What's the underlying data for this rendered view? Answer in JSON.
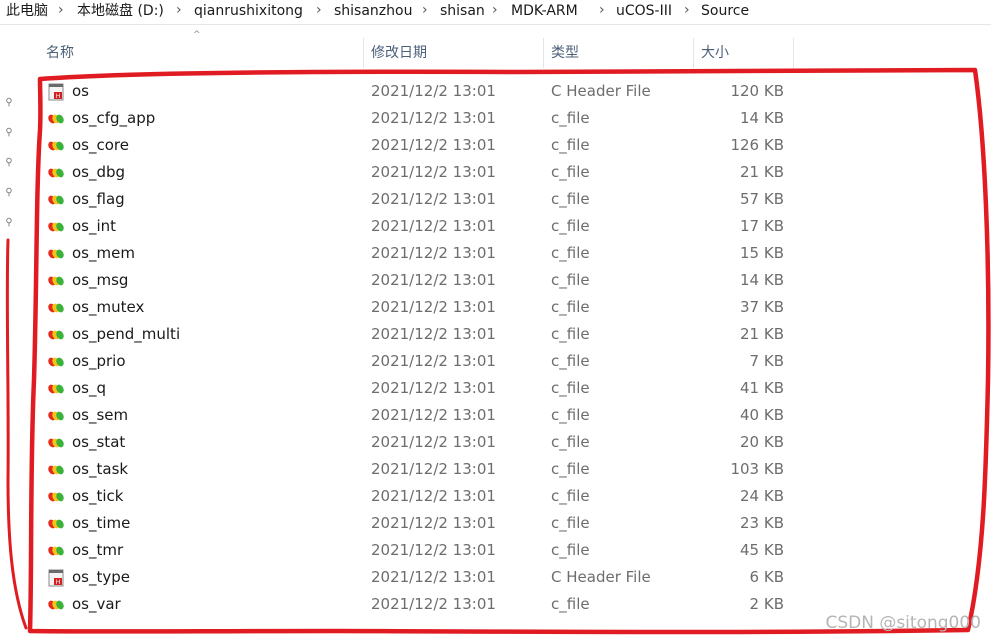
{
  "breadcrumb": [
    "此电脑",
    "本地磁盘 (D:)",
    "qianrushixitong",
    "shisanzhou",
    "shisan",
    "MDK-ARM",
    "uCOS-III",
    "Source"
  ],
  "columns": {
    "name": "名称",
    "date": "修改日期",
    "type": "类型",
    "size": "大小"
  },
  "files": [
    {
      "name": "os",
      "date": "2021/12/2 13:01",
      "type": "C Header File",
      "size": "120 KB",
      "icon": "h-file-icon"
    },
    {
      "name": "os_cfg_app",
      "date": "2021/12/2 13:01",
      "type": "c_file",
      "size": "14 KB",
      "icon": "c-file-icon"
    },
    {
      "name": "os_core",
      "date": "2021/12/2 13:01",
      "type": "c_file",
      "size": "126 KB",
      "icon": "c-file-icon"
    },
    {
      "name": "os_dbg",
      "date": "2021/12/2 13:01",
      "type": "c_file",
      "size": "21 KB",
      "icon": "c-file-icon"
    },
    {
      "name": "os_flag",
      "date": "2021/12/2 13:01",
      "type": "c_file",
      "size": "57 KB",
      "icon": "c-file-icon"
    },
    {
      "name": "os_int",
      "date": "2021/12/2 13:01",
      "type": "c_file",
      "size": "17 KB",
      "icon": "c-file-icon"
    },
    {
      "name": "os_mem",
      "date": "2021/12/2 13:01",
      "type": "c_file",
      "size": "15 KB",
      "icon": "c-file-icon"
    },
    {
      "name": "os_msg",
      "date": "2021/12/2 13:01",
      "type": "c_file",
      "size": "14 KB",
      "icon": "c-file-icon"
    },
    {
      "name": "os_mutex",
      "date": "2021/12/2 13:01",
      "type": "c_file",
      "size": "37 KB",
      "icon": "c-file-icon"
    },
    {
      "name": "os_pend_multi",
      "date": "2021/12/2 13:01",
      "type": "c_file",
      "size": "21 KB",
      "icon": "c-file-icon"
    },
    {
      "name": "os_prio",
      "date": "2021/12/2 13:01",
      "type": "c_file",
      "size": "7 KB",
      "icon": "c-file-icon"
    },
    {
      "name": "os_q",
      "date": "2021/12/2 13:01",
      "type": "c_file",
      "size": "41 KB",
      "icon": "c-file-icon"
    },
    {
      "name": "os_sem",
      "date": "2021/12/2 13:01",
      "type": "c_file",
      "size": "40 KB",
      "icon": "c-file-icon"
    },
    {
      "name": "os_stat",
      "date": "2021/12/2 13:01",
      "type": "c_file",
      "size": "20 KB",
      "icon": "c-file-icon"
    },
    {
      "name": "os_task",
      "date": "2021/12/2 13:01",
      "type": "c_file",
      "size": "103 KB",
      "icon": "c-file-icon"
    },
    {
      "name": "os_tick",
      "date": "2021/12/2 13:01",
      "type": "c_file",
      "size": "24 KB",
      "icon": "c-file-icon"
    },
    {
      "name": "os_time",
      "date": "2021/12/2 13:01",
      "type": "c_file",
      "size": "23 KB",
      "icon": "c-file-icon"
    },
    {
      "name": "os_tmr",
      "date": "2021/12/2 13:01",
      "type": "c_file",
      "size": "45 KB",
      "icon": "c-file-icon"
    },
    {
      "name": "os_type",
      "date": "2021/12/2 13:01",
      "type": "C Header File",
      "size": "6 KB",
      "icon": "h-file-icon"
    },
    {
      "name": "os_var",
      "date": "2021/12/2 13:01",
      "type": "c_file",
      "size": "2 KB",
      "icon": "c-file-icon"
    }
  ],
  "watermark": "CSDN @sitong000",
  "colors": {
    "annotation": "#e01b22",
    "header_text": "#4c607a",
    "secondary_text": "#6d6d6d"
  }
}
